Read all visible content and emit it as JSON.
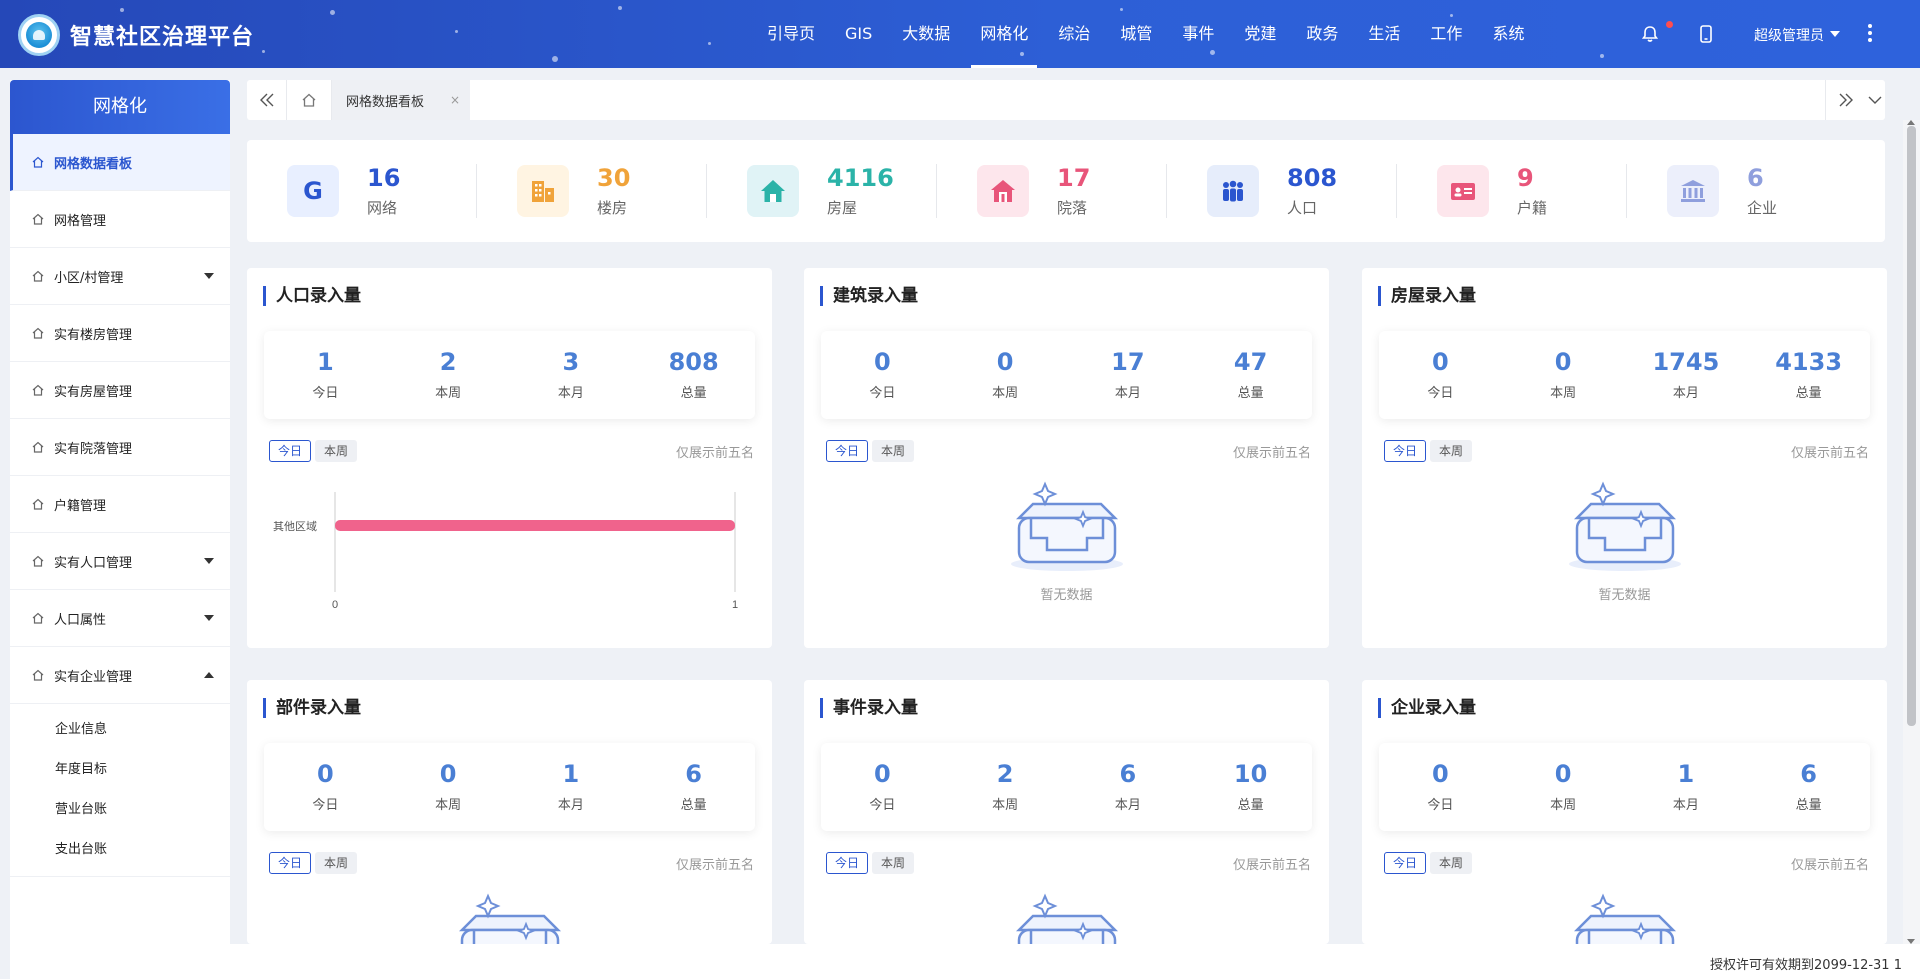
{
  "app": {
    "title": "智慧社区治理平台"
  },
  "topnav": {
    "items": [
      {
        "label": "引导页"
      },
      {
        "label": "GIS"
      },
      {
        "label": "大数据"
      },
      {
        "label": "网格化"
      },
      {
        "label": "综治"
      },
      {
        "label": "城管"
      },
      {
        "label": "事件"
      },
      {
        "label": "党建"
      },
      {
        "label": "政务"
      },
      {
        "label": "生活"
      },
      {
        "label": "工作"
      },
      {
        "label": "系统"
      }
    ],
    "active": "网格化",
    "user": "超级管理员"
  },
  "sidebar": {
    "title": "网格化",
    "items": [
      {
        "label": "网格数据看板"
      },
      {
        "label": "网格管理"
      },
      {
        "label": "小区/村管理"
      },
      {
        "label": "实有楼房管理"
      },
      {
        "label": "实有房屋管理"
      },
      {
        "label": "实有院落管理"
      },
      {
        "label": "户籍管理"
      },
      {
        "label": "实有人口管理"
      },
      {
        "label": "人口属性"
      },
      {
        "label": "实有企业管理"
      }
    ],
    "subitems": [
      {
        "label": "企业信息"
      },
      {
        "label": "年度目标"
      },
      {
        "label": "营业台账"
      },
      {
        "label": "支出台账"
      }
    ]
  },
  "tabs": {
    "active_label": "网格数据看板",
    "close": "×"
  },
  "stats": [
    {
      "icon": "grid-letter-icon",
      "glyph": "G",
      "value": "16",
      "label": "网络",
      "color": "#2b56cf",
      "bg": "#e8efff"
    },
    {
      "icon": "building-icon",
      "value": "30",
      "label": "楼房",
      "color": "#f0a33a",
      "bg": "#fff4e2"
    },
    {
      "icon": "house-icon",
      "value": "4116",
      "label": "房屋",
      "color": "#2bb3a8",
      "bg": "#e0f3f6"
    },
    {
      "icon": "courtyard-icon",
      "value": "17",
      "label": "院落",
      "color": "#e8557a",
      "bg": "#fde6ec"
    },
    {
      "icon": "people-icon",
      "value": "808",
      "label": "人口",
      "color": "#2b56cf",
      "bg": "#e6edfb"
    },
    {
      "icon": "id-card-icon",
      "value": "9",
      "label": "户籍",
      "color": "#e8557a",
      "bg": "#fde6ec"
    },
    {
      "icon": "enterprise-icon",
      "value": "6",
      "label": "企业",
      "color": "#8f9fdd",
      "bg": "#eceffb"
    }
  ],
  "labels": {
    "today": "今日",
    "week": "本周",
    "month": "本月",
    "total": "总量",
    "top5": "仅展示前五名",
    "empty": "暂无数据"
  },
  "cards": [
    {
      "title": "人口录入量",
      "values": [
        "1",
        "2",
        "3",
        "808"
      ]
    },
    {
      "title": "建筑录入量",
      "values": [
        "0",
        "0",
        "17",
        "47"
      ]
    },
    {
      "title": "房屋录入量",
      "values": [
        "0",
        "0",
        "1745",
        "4133"
      ]
    },
    {
      "title": "部件录入量",
      "values": [
        "0",
        "0",
        "1",
        "6"
      ]
    },
    {
      "title": "事件录入量",
      "values": [
        "0",
        "2",
        "6",
        "10"
      ]
    },
    {
      "title": "企业录入量",
      "values": [
        "0",
        "0",
        "1",
        "6"
      ]
    }
  ],
  "chart_data": {
    "type": "bar",
    "orientation": "horizontal",
    "categories": [
      "其他区域"
    ],
    "values": [
      1
    ],
    "xlim": [
      0,
      1
    ],
    "xticks": [
      "0",
      "1"
    ],
    "color": "#f0638c"
  },
  "footer": {
    "license": "授权许可有效期到2099-12-31 1"
  }
}
